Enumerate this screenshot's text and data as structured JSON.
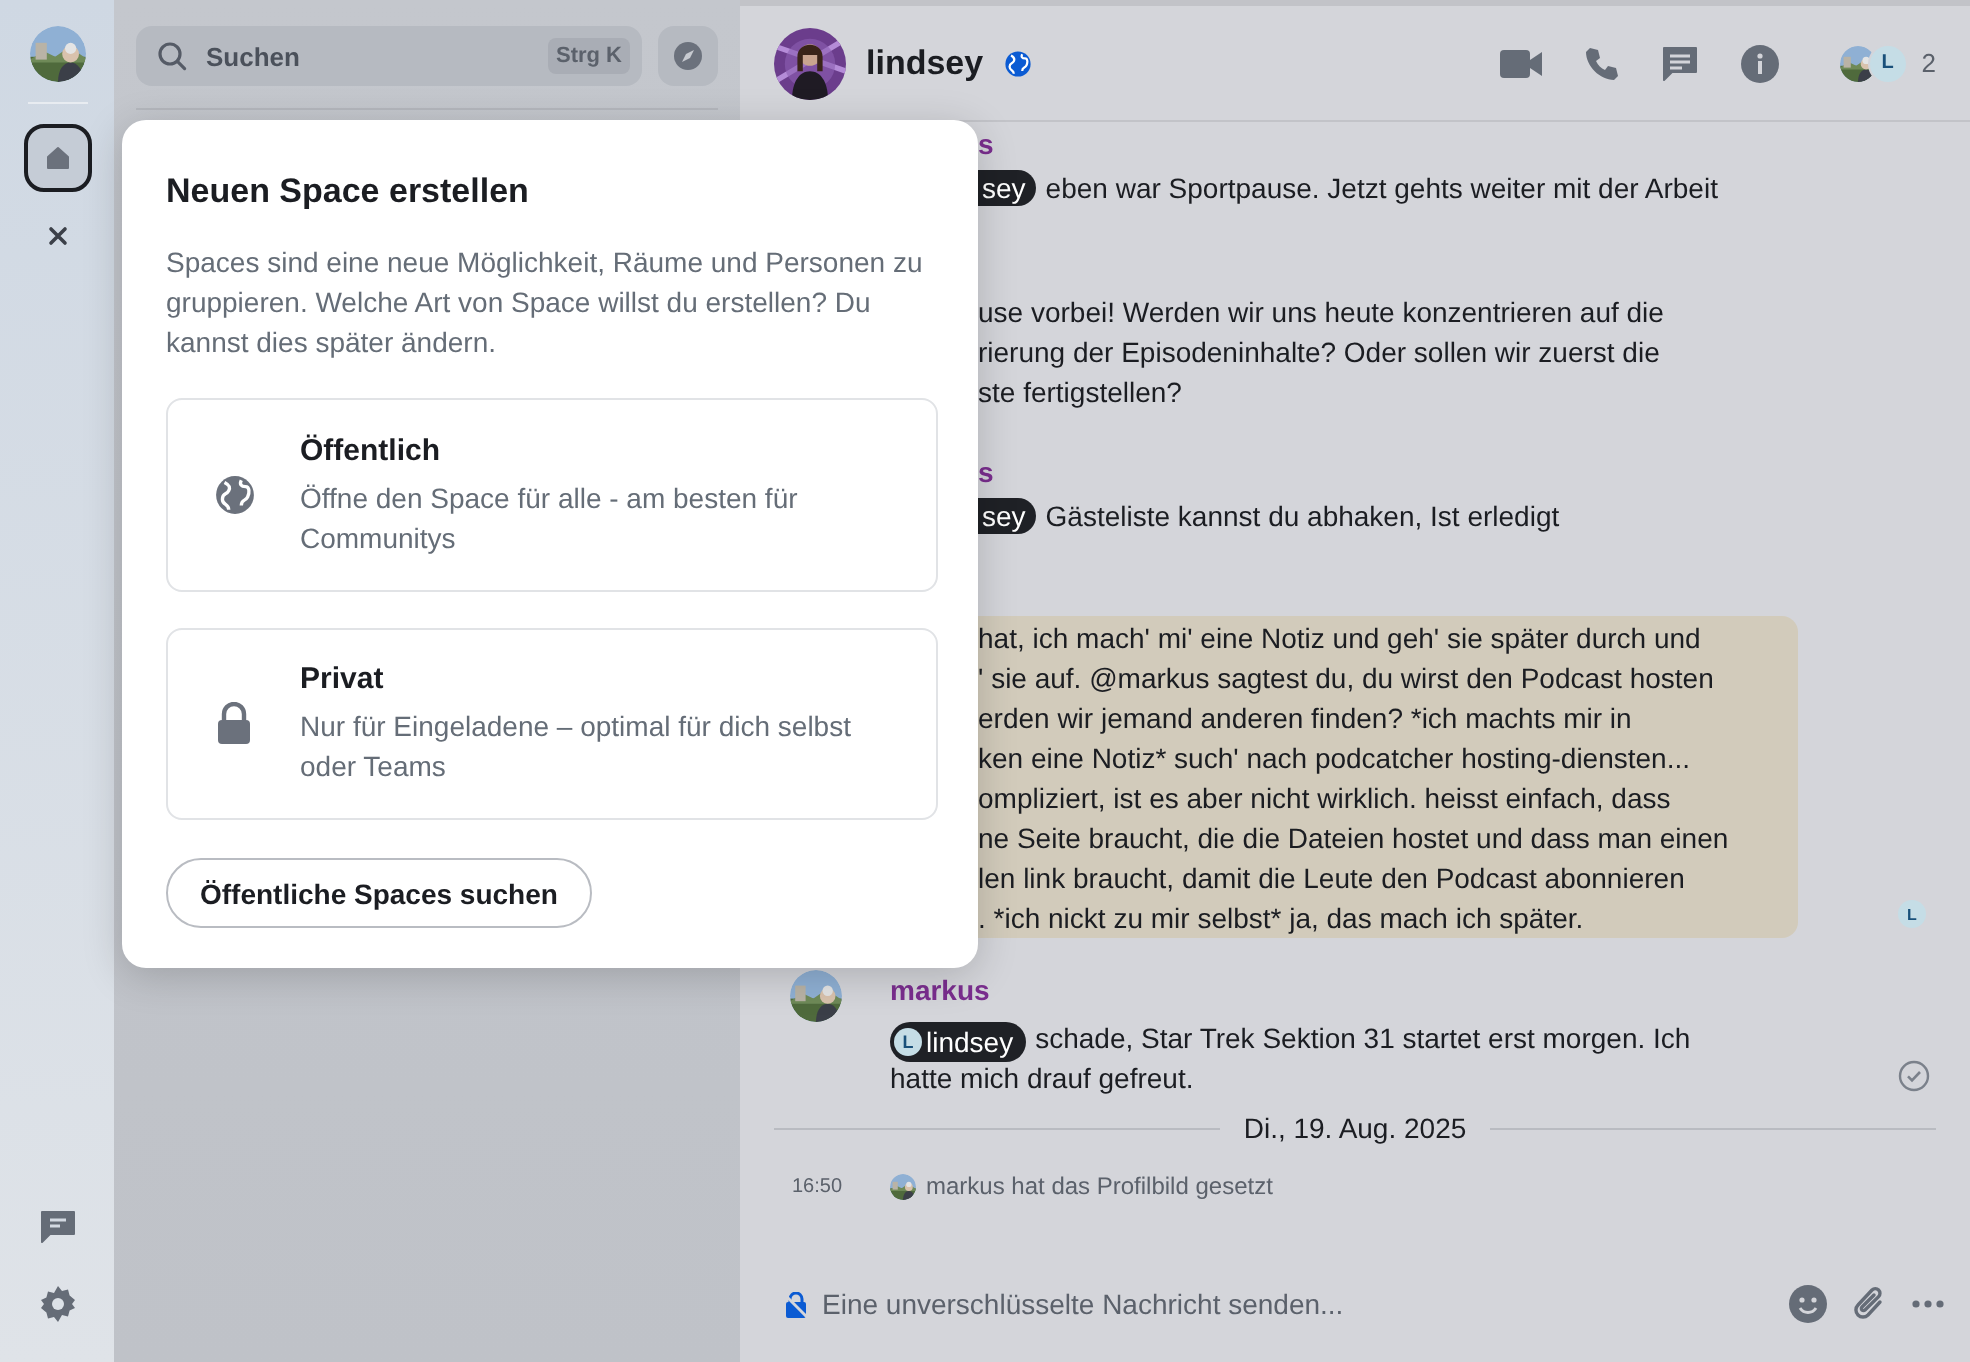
{
  "space_bar": {
    "home": {
      "selected": true
    }
  },
  "room_list": {
    "search": {
      "placeholder": "Suchen",
      "shortcut": "Strg K"
    }
  },
  "room": {
    "name": "lindsey",
    "facepile_initial": "L",
    "member_count": "2"
  },
  "messages": [
    {
      "kind": "clipped",
      "sender": "s",
      "pill": "sey",
      "lines": [
        "eben war Sportpause. Jetzt gehts weiter mit der Arbeit"
      ]
    },
    {
      "kind": "clipped",
      "lines": [
        "use vorbei! Werden wir uns heute konzentrieren auf die",
        "rierung der Episodeninhalte? Oder sollen wir zuerst die",
        "ste fertigstellen?"
      ]
    },
    {
      "kind": "clipped",
      "sender": "s",
      "pill": "sey",
      "lines": [
        "Gästeliste kannst du abhaken, Ist erledigt"
      ]
    },
    {
      "kind": "highlight",
      "receipt": "L",
      "lines": [
        "hat, ich mach' mi' eine Notiz und geh' sie später durch und",
        "' sie auf. @markus sagtest du, du wirst den Podcast hosten",
        "erden wir jemand anderen finden? *ich machts mir in",
        "ken eine Notiz* such' nach podcatcher hosting-diensten...",
        "ompliziert, ist es aber nicht wirklich. heisst einfach, dass",
        "ne Seite braucht, die die Dateien hostet und dass man einen",
        "len link braucht, damit die Leute den Podcast abonnieren",
        ". *ich nickt zu mir selbst* ja, das mach ich später."
      ]
    },
    {
      "kind": "full",
      "sender": "markus",
      "pill_initial": "L",
      "pill": "lindsey",
      "lines": [
        "schade, Star Trek Sektion 31 startet erst morgen. Ich",
        "hatte mich drauf gefreut."
      ]
    }
  ],
  "date_separator": "Di., 19. Aug. 2025",
  "event": {
    "time": "16:50",
    "text": "markus hat das Profilbild gesetzt"
  },
  "composer": {
    "placeholder": "Eine unverschlüsselte Nachricht senden..."
  },
  "dialog": {
    "title": "Neuen Space erstellen",
    "description": "Spaces sind eine neue Möglichkeit, Räume und Personen zu gruppieren. Welche Art von Space willst du erstellen? Du kannst dies später ändern.",
    "options": [
      {
        "kind": "public",
        "title": "Öffentlich",
        "description": "Öffne den Space für alle - am besten für Communitys"
      },
      {
        "kind": "private",
        "title": "Privat",
        "description": "Nur für Eingeladene – optimal für dich selbst oder Teams"
      }
    ],
    "button": "Öffentliche Spaces suchen"
  }
}
